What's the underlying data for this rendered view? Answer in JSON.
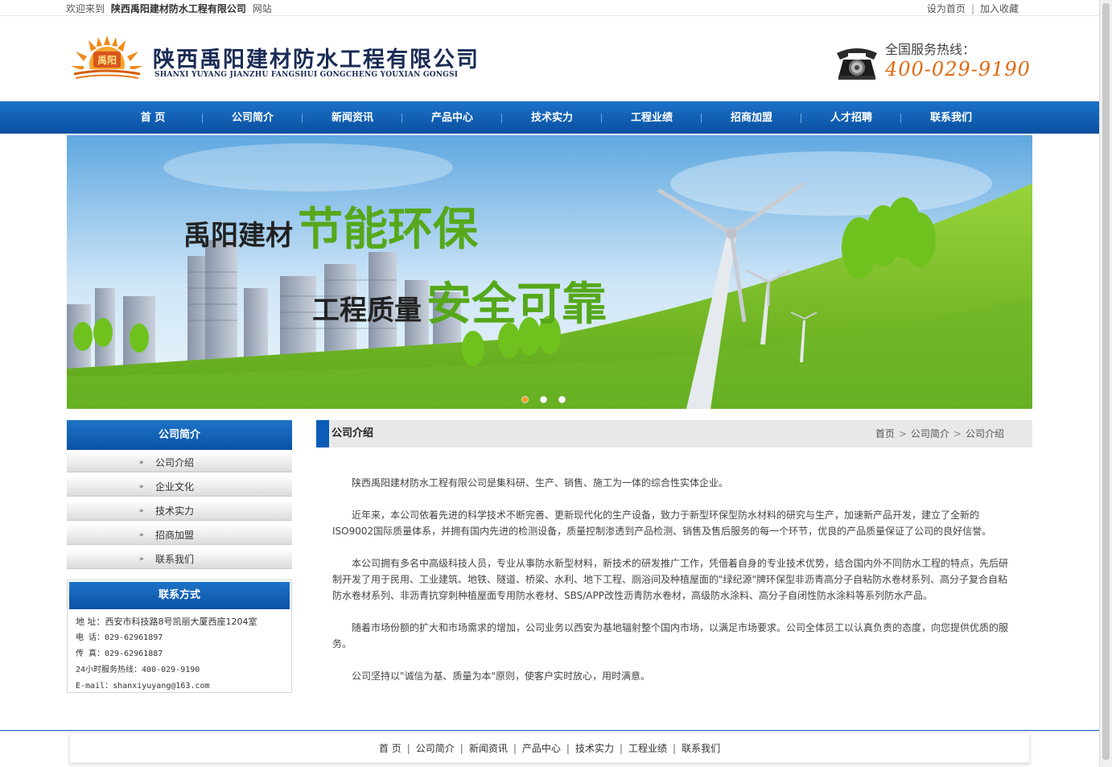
{
  "topbar": {
    "welcome_prefix": "欢迎来到",
    "company": "陕西禹阳建材防水工程有限公司",
    "welcome_suffix": "网站",
    "set_home": "设为首页",
    "add_favorite": "加入收藏"
  },
  "header": {
    "logo_text": "禹阳",
    "company_cn": "陕西禹阳建材防水工程有限公司",
    "company_en": "SHANXI YUYANG JIANZHU FANGSHUI GONGCHENG YOUXIAN GONGSI",
    "hotline_label": "全国服务热线：",
    "hotline_number": "400-029-9190"
  },
  "nav": [
    "首 页",
    "公司简介",
    "新闻资讯",
    "产品中心",
    "技术实力",
    "工程业绩",
    "招商加盟",
    "人才招聘",
    "联系我们"
  ],
  "banner": {
    "line1_dark": "禹阳建材",
    "line1_green": "节能环保",
    "line2_dark": "工程质量",
    "line2_green": "安全可靠",
    "active_slide": 1,
    "slide_count": 3
  },
  "sidebar": {
    "title": "公司简介",
    "items": [
      "公司介绍",
      "企业文化",
      "技术实力",
      "招商加盟",
      "联系我们"
    ],
    "contact_title": "联系方式",
    "contact_lines": [
      "地 址：西安市科技路8号凯丽大厦西座1204室",
      "电 话：029-62961897",
      "传 真：029-62961887",
      "24小时服务热线：400-029-9190",
      "E-mail：shanxiyuyang@163.com"
    ]
  },
  "main": {
    "title": "公司介绍",
    "breadcrumb": [
      "首页",
      "公司简介",
      "公司介绍"
    ],
    "paragraphs": [
      "　　陕西禹阳建材防水工程有限公司是集科研、生产、销售、施工为一体的综合性实体企业。",
      "　　近年来，本公司依着先进的科学技术不断完善、更新现代化的生产设备，致力于新型环保型防水材料的研究与生产，加速新产品开发，建立了全新的ISO9002国际质量体系，并拥有国内先进的检测设备，质量控制渗透到产品检测、销售及售后服务的每一个环节，优良的产品质量保证了公司的良好信誉。",
      "　　本公司拥有多名中高级科技人员，专业从事防水新型材料，新技术的研发推广工作，凭借着自身的专业技术优势，结合国内外不同防水工程的特点，先后研制开发了用于民用、工业建筑、地铁、隧道、桥梁、水利、地下工程、厕浴间及种植屋面的\"绿纪源\"牌环保型非沥青高分子自粘防水卷材系列、高分子复合自粘防水卷材系列、非沥青抗穿刺种植屋面专用防水卷材、SBS/APP改性沥青防水卷材，高级防水涂料、高分子自闭性防水涂料等系列防水产品。",
      "　　随着市场份额的扩大和市场需求的增加，公司业务以西安为基地辐射整个国内市场，以满足市场要求。公司全体员工以认真负责的态度，向您提供优质的服务。",
      "　　公司坚持以\"诚信为基、质量为本\"原则，使客户实时放心，用时满意。"
    ]
  },
  "footer": [
    "首 页",
    "公司简介",
    "新闻资讯",
    "产品中心",
    "技术实力",
    "工程业绩",
    "联系我们"
  ],
  "colors": {
    "primary_blue": "#0a5cb8",
    "accent_orange": "#e06a10",
    "slogan_green": "#55a81a"
  }
}
